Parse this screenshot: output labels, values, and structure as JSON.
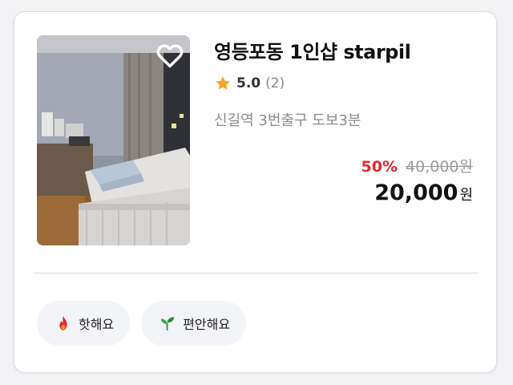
{
  "listing": {
    "title": "영등포동 1인샵 starpil",
    "rating": {
      "score": "5.0",
      "count": "(2)",
      "icon": "star-icon"
    },
    "location": "신길역 3번출구 도보3분",
    "price": {
      "discount": "50%",
      "original": "40,000원",
      "sale_amount": "20,000",
      "sale_unit": "원"
    },
    "favorite_icon": "heart-outline-icon"
  },
  "tags": [
    {
      "label": "핫해요",
      "icon": "fire-icon"
    },
    {
      "label": "편안해요",
      "icon": "leaf-sprout-icon"
    }
  ],
  "colors": {
    "discount": "#e8242c",
    "star": "#f5a623",
    "muted_text": "#8a8a8f",
    "tag_background": "#f3f4f7"
  }
}
